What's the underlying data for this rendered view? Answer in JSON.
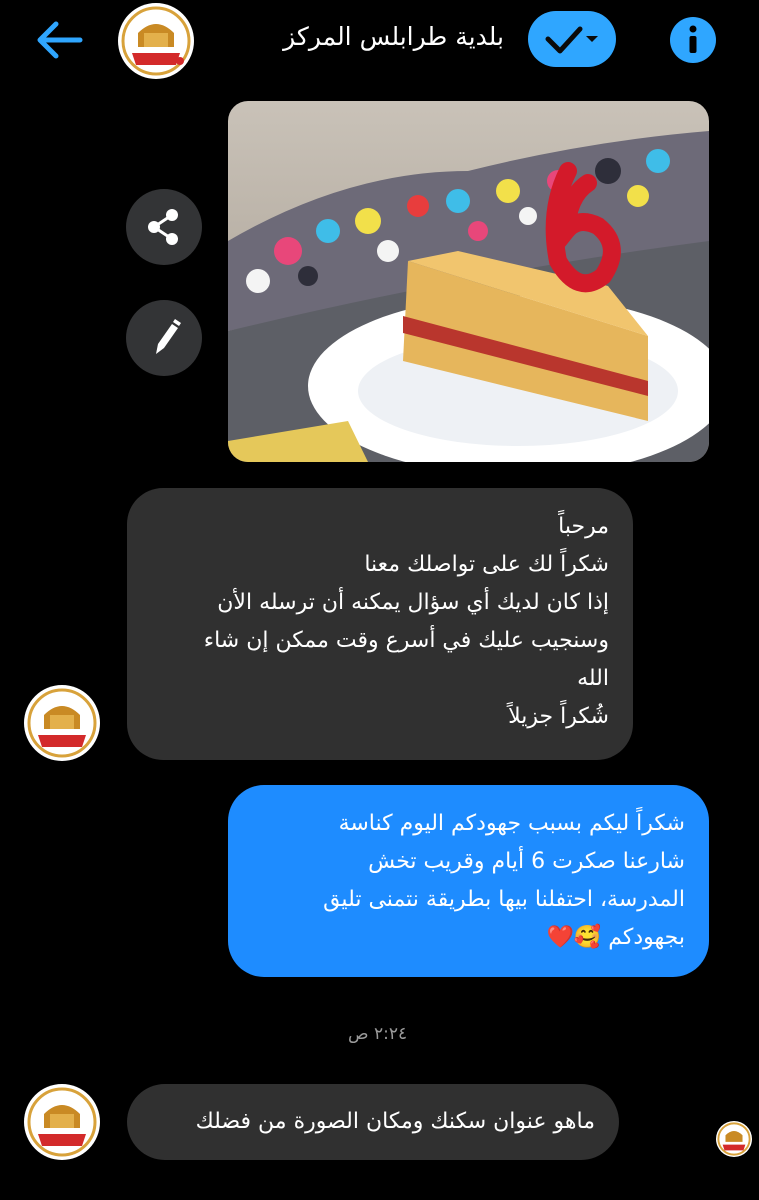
{
  "header": {
    "title": "بلدية طرابلس المركز",
    "accent_color": "#2fa6ff"
  },
  "messages": {
    "incoming_1": {
      "lines": [
        "مرحباً",
        "شكراً لك على تواصلك معنا",
        "إذا كان لديك أي سؤال يمكنه أن ترسله الأن",
        "وسنجيب عليك في أسرع وقت ممكن إن شاء",
        "الله",
        "شُكراً جزيلاً"
      ]
    },
    "outgoing_1": {
      "lines": [
        "شكراً ليكم بسبب جهودكم اليوم كناسة",
        "شارعنا صكرت 6 أيام وقريب تخش",
        "المدرسة، احتفلنا بيها بطريقة نتمنى تليق",
        "بجهودكم"
      ],
      "emoji": "🥰❤️"
    },
    "timestamp": "٢:٢٤ ص",
    "incoming_2": {
      "text": "ماهو عنوان سكنك ومكان الصورة من فضلك"
    }
  },
  "photo": {
    "candle_number": "6"
  },
  "icons": {
    "back": "back-arrow-icon",
    "check": "checkmark-icon",
    "info": "info-icon",
    "share": "share-icon",
    "edit": "pencil-icon"
  }
}
